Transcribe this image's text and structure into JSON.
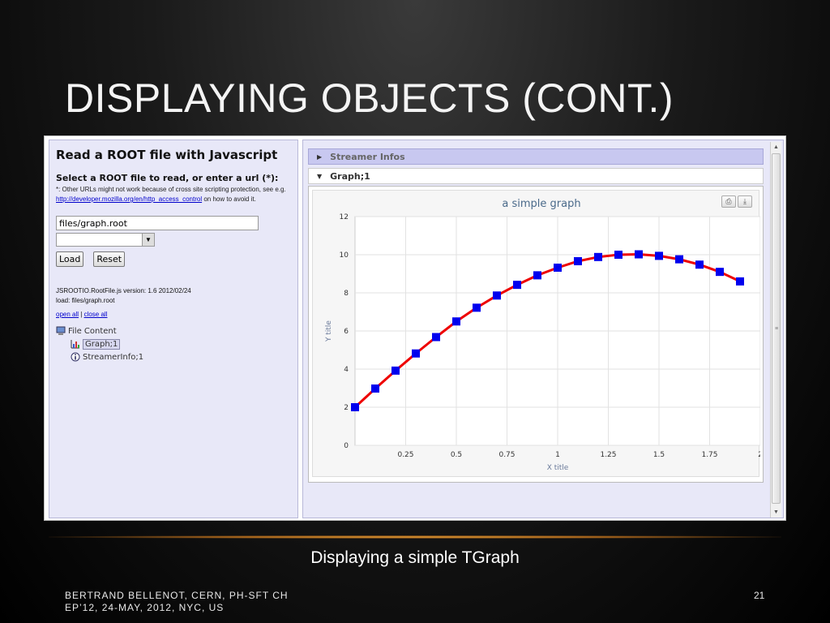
{
  "slide": {
    "title": "DISPLAYING OBJECTS (CONT.)",
    "caption": "Displaying a simple TGraph",
    "footer_line1": "BERTRAND BELLENOT, CERN, PH-SFT CH",
    "footer_line2": "EP’12, 24-MAY, 2012, NYC, US",
    "page_number": "21"
  },
  "left_panel": {
    "heading": "Read a ROOT file with Javascript",
    "subheading": "Select a ROOT file to read, or enter a url (*):",
    "note_prefix": "*: Other URLs might not work because of cross site scripting protection, see e.g. ",
    "note_link": "http://developer.mozilla.org/en/http_access_control",
    "note_suffix": " on how to avoid it.",
    "file_input_value": "files/graph.root",
    "select_value": "",
    "load_button": "Load",
    "reset_button": "Reset",
    "version_line": "JSROOTIO.RootFile.js version: 1.6 2012/02/24",
    "load_line": "load: files/graph.root",
    "open_all": "open all",
    "separator": "|",
    "close_all": "close all",
    "tree": {
      "root_label": "File Content",
      "items": [
        {
          "label": "Graph;1",
          "icon": "graph-icon"
        },
        {
          "label": "StreamerInfo;1",
          "icon": "info-icon"
        }
      ]
    }
  },
  "right_panel": {
    "streamer_header": "Streamer Infos",
    "graph_header": "Graph;1"
  },
  "chart_data": {
    "type": "line",
    "title": "a simple graph",
    "xlabel": "X title",
    "ylabel": "Y title",
    "xlim": [
      0,
      2
    ],
    "ylim": [
      0,
      12
    ],
    "xticks": [
      "0.25",
      "0.5",
      "0.75",
      "1",
      "1.25",
      "1.5",
      "1.75",
      "2"
    ],
    "yticks": [
      "0",
      "2",
      "4",
      "6",
      "8",
      "10",
      "12"
    ],
    "grid": true,
    "line_color": "#ee0000",
    "marker_color": "#0000ee",
    "series": [
      {
        "x": [
          0,
          0.1,
          0.2,
          0.3,
          0.4,
          0.5,
          0.6,
          0.7,
          0.8,
          0.9,
          1.0,
          1.1,
          1.2,
          1.3,
          1.4,
          1.5,
          1.6,
          1.7,
          1.8,
          1.9
        ],
        "values": [
          2.0,
          2.98,
          3.92,
          4.82,
          5.68,
          6.5,
          7.22,
          7.86,
          8.42,
          8.92,
          9.32,
          9.66,
          9.88,
          10.0,
          10.02,
          9.94,
          9.76,
          9.48,
          9.1,
          8.6
        ]
      }
    ]
  }
}
